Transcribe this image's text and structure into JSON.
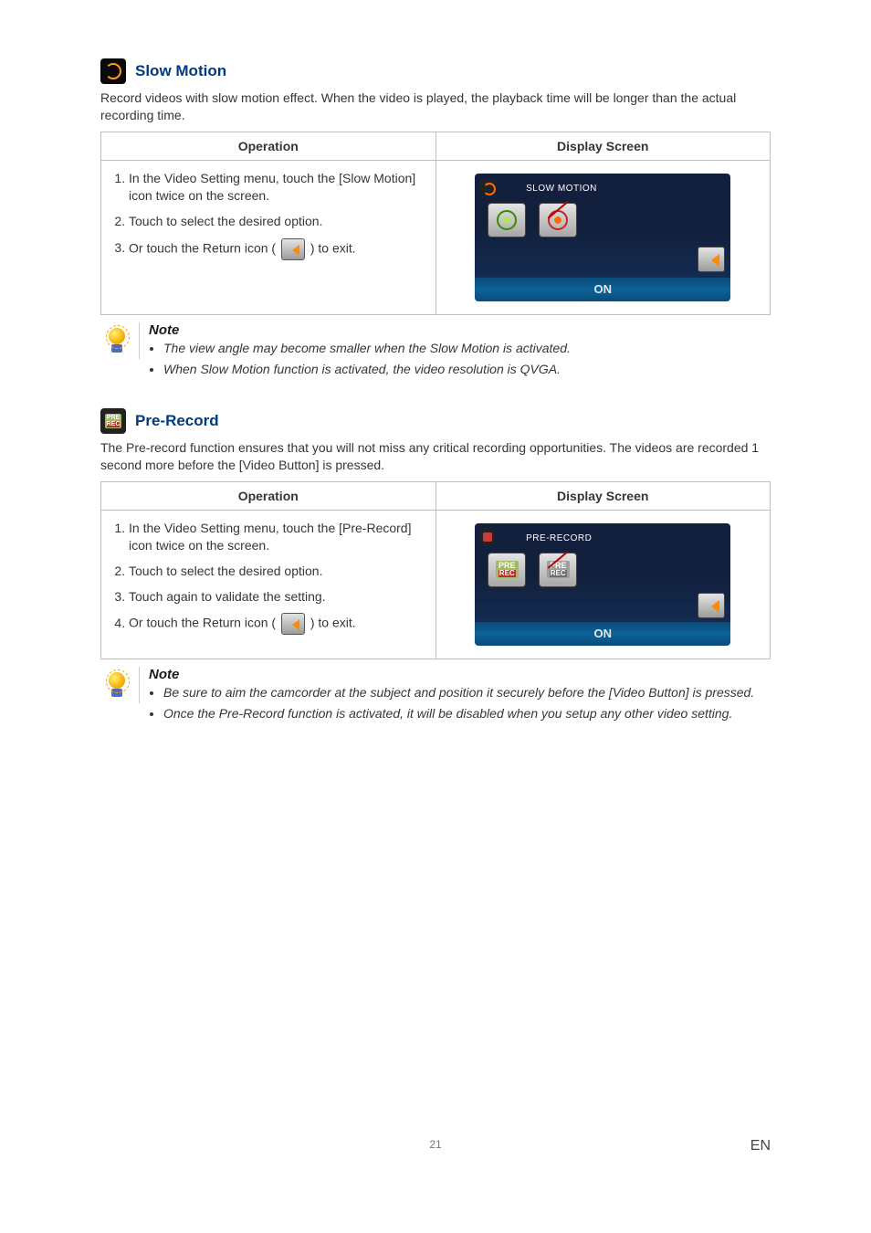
{
  "slowMotion": {
    "heading": "Slow Motion",
    "intro": "Record videos with slow motion effect. When the video is played, the playback time will be longer than the actual recording time.",
    "table": {
      "col1": "Operation",
      "col2": "Display Screen",
      "step1": "In the Video Setting menu, touch the [Slow Motion] icon twice on the screen.",
      "step2": "Touch to select the desired option.",
      "step3a": "Or touch the Return icon (",
      "step3b": ") to exit."
    },
    "display": {
      "title": "SLOW MOTION",
      "status": "ON"
    },
    "noteHeading": "Note",
    "note1": "The view angle may become smaller when the Slow Motion is activated.",
    "note2": "When Slow Motion function is activated, the video resolution is QVGA."
  },
  "preRecord": {
    "heading": "Pre-Record",
    "intro": "The Pre-record function ensures that you will not miss any critical recording opportunities. The videos are recorded 1 second more before the [Video Button] is pressed.",
    "table": {
      "col1": "Operation",
      "col2": "Display Screen",
      "step1": "In the Video Setting menu, touch the [Pre-Record] icon twice on the screen.",
      "step2": "Touch to select the desired option.",
      "step3": "Touch again to validate the setting.",
      "step4a": "Or touch the Return icon (",
      "step4b": ") to exit."
    },
    "display": {
      "title": "PRE-RECORD",
      "status": "ON",
      "pre": "PRE",
      "rec": "REC"
    },
    "noteHeading": "Note",
    "note1": "Be sure to aim the camcorder at the subject and position it securely before the [Video Button] is pressed.",
    "note2": "Once the Pre-Record function is activated, it will be disabled when you setup any other video setting."
  },
  "footer": {
    "pageNum": "21",
    "lang": "EN"
  }
}
